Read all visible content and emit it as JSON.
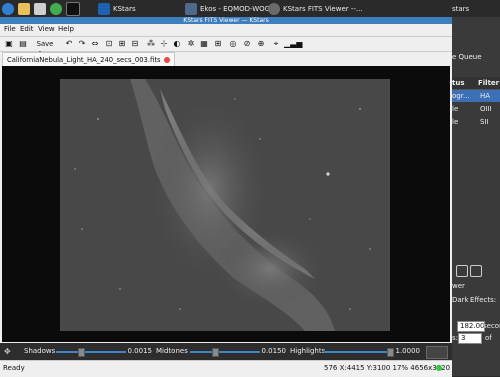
{
  "taskbar": {
    "apps": [
      {
        "label": "KStars",
        "icon": "kstars-icon"
      },
      {
        "label": "Ekos - EQMOD-WOGT...",
        "icon": "ekos-icon"
      },
      {
        "label": "KStars FITS Viewer --...",
        "icon": "fits-icon"
      }
    ],
    "right_label": "KStars"
  },
  "window": {
    "title": "KStars FITS Viewer — KStars",
    "menu": [
      "File",
      "Edit",
      "View",
      "Help"
    ],
    "save_as_label": "Save As...",
    "tab_label": "CaliforniaNebula_Light_HA_240_secs_003.fits"
  },
  "sliders": {
    "shadows": {
      "label": "Shadows",
      "value": "0.0015",
      "level": 0.35
    },
    "midtones": {
      "label": "Midtones",
      "value": "0.0150",
      "level": 0.35
    },
    "highlights": {
      "label": "Highlights",
      "value": "1.0000",
      "level": 1.0
    }
  },
  "status": {
    "ready": "Ready",
    "info": "576  X:4415 Y:3100  17%  4656x3520"
  },
  "right_panel": {
    "queue_label": "e Queue",
    "columns": [
      "tus",
      "Filter"
    ],
    "rows": [
      {
        "status": "ogr...",
        "filter": "HA",
        "selected": true
      },
      {
        "status": "le",
        "filter": "OIII",
        "selected": false
      },
      {
        "status": "le",
        "filter": "SII",
        "selected": false
      }
    ],
    "over_label": "wer",
    "dark_label": "Dark",
    "effects_label": "Effects:",
    "exposure_value": "182.00",
    "exposure_unit": "secon",
    "count_label": "s:",
    "count_value": "3",
    "of_label": "of",
    "taskbar_label": "stars"
  }
}
